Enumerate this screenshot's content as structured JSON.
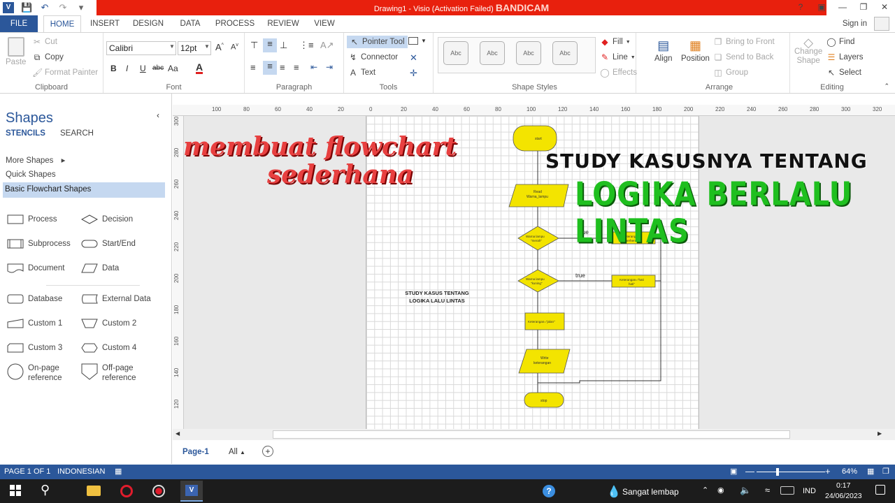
{
  "titlebar": {
    "title": "Drawing1 - Visio (Activation Failed)",
    "watermark": "BANDICAM"
  },
  "tabs": [
    {
      "label": "FILE"
    },
    {
      "label": "HOME"
    },
    {
      "label": "INSERT"
    },
    {
      "label": "DESIGN"
    },
    {
      "label": "DATA"
    },
    {
      "label": "PROCESS"
    },
    {
      "label": "REVIEW"
    },
    {
      "label": "VIEW"
    }
  ],
  "account": {
    "signin": "Sign in"
  },
  "ribbon": {
    "clipboard": {
      "label": "Clipboard",
      "paste": "Paste",
      "cut": "Cut",
      "copy": "Copy",
      "format_painter": "Format Painter"
    },
    "font": {
      "label": "Font",
      "family": "Calibri",
      "size": "12pt",
      "bold": "B",
      "italic": "I",
      "underline": "U",
      "strike": "abc",
      "case": "Aa",
      "color": "A"
    },
    "paragraph": {
      "label": "Paragraph"
    },
    "tools": {
      "label": "Tools",
      "pointer": "Pointer Tool",
      "connector": "Connector",
      "text": "Text"
    },
    "shape_styles": {
      "label": "Shape Styles",
      "style_sample": "Abc",
      "fill": "Fill",
      "line": "Line",
      "effects": "Effects"
    },
    "arrange": {
      "label": "Arrange",
      "align": "Align",
      "position": "Position",
      "bring_to_front": "Bring to Front",
      "send_to_back": "Send to Back",
      "group": "Group"
    },
    "editing": {
      "label": "Editing",
      "change_shape_1": "Change",
      "change_shape_2": "Shape",
      "find": "Find",
      "layers": "Layers",
      "select": "Select"
    }
  },
  "shapes_panel": {
    "title": "Shapes",
    "stencils": "STENCILS",
    "search": "SEARCH",
    "more_shapes": "More Shapes",
    "quick_shapes": "Quick Shapes",
    "basic_flowchart": "Basic Flowchart Shapes",
    "shapes": [
      {
        "label": "Process",
        "icon": "process-shape-icon"
      },
      {
        "label": "Decision",
        "icon": "decision-shape-icon"
      },
      {
        "label": "Subprocess",
        "icon": "subprocess-shape-icon"
      },
      {
        "label": "Start/End",
        "icon": "start-end-shape-icon"
      },
      {
        "label": "Document",
        "icon": "document-shape-icon"
      },
      {
        "label": "Data",
        "icon": "data-shape-icon"
      },
      {
        "label": "Database",
        "icon": "database-shape-icon"
      },
      {
        "label": "External Data",
        "icon": "external-data-shape-icon"
      },
      {
        "label": "Custom 1",
        "icon": "custom1-shape-icon"
      },
      {
        "label": "Custom 2",
        "icon": "custom2-shape-icon"
      },
      {
        "label": "Custom 3",
        "icon": "custom3-shape-icon"
      },
      {
        "label": "Custom 4",
        "icon": "custom4-shape-icon"
      },
      {
        "label": "On-page reference",
        "icon": "on-page-reference-icon"
      },
      {
        "label": "Off-page reference",
        "icon": "off-page-reference-icon"
      }
    ]
  },
  "ruler": {
    "h_ticks": [
      "100",
      "80",
      "60",
      "40",
      "20",
      "0",
      "20",
      "40",
      "60",
      "80",
      "100",
      "120",
      "140",
      "160",
      "180",
      "200",
      "220",
      "240",
      "260",
      "280",
      "300",
      "320"
    ],
    "v_ticks": [
      "300",
      "280",
      "260",
      "240",
      "220",
      "200",
      "180",
      "160",
      "140",
      "120"
    ]
  },
  "overlay": {
    "line1": "membuat flowchart",
    "line2": "sederhana",
    "study": "STUDY KASUSNYA TENTANG",
    "logika": "LOGIKA BERLALU LINTAS"
  },
  "flowchart": {
    "start": "start",
    "read_1": "Read",
    "read_2": "Warna_lampu",
    "dec1_1": "Warna lampu",
    "dec1_2": "\"merah\"",
    "dec2_1": "Warna lampu",
    "dec2_2": "\"kuning\"",
    "true1": "true",
    "true2": "true",
    "ket1_1": "Keterangan=",
    "ket1_2": "\"berhenti\"",
    "ket2_1": "Keterangan=\"hati",
    "ket2_2": "hati\"",
    "ket3": "Keterangan=\"jalan\"",
    "write_1": "Write",
    "write_2": "keterangan",
    "end": "stop",
    "note_1": "STUDY KASUS TENTANG",
    "note_2": "LOGIKA LALU LINTAS"
  },
  "page_tabs": {
    "page1": "Page-1",
    "all": "All"
  },
  "status": {
    "page": "PAGE 1 OF 1",
    "language": "INDONESIAN",
    "zoom": "64%"
  },
  "taskbar": {
    "weather": "Sangat lembap",
    "lang": "IND",
    "time": "0:17",
    "date": "24/06/2023"
  }
}
